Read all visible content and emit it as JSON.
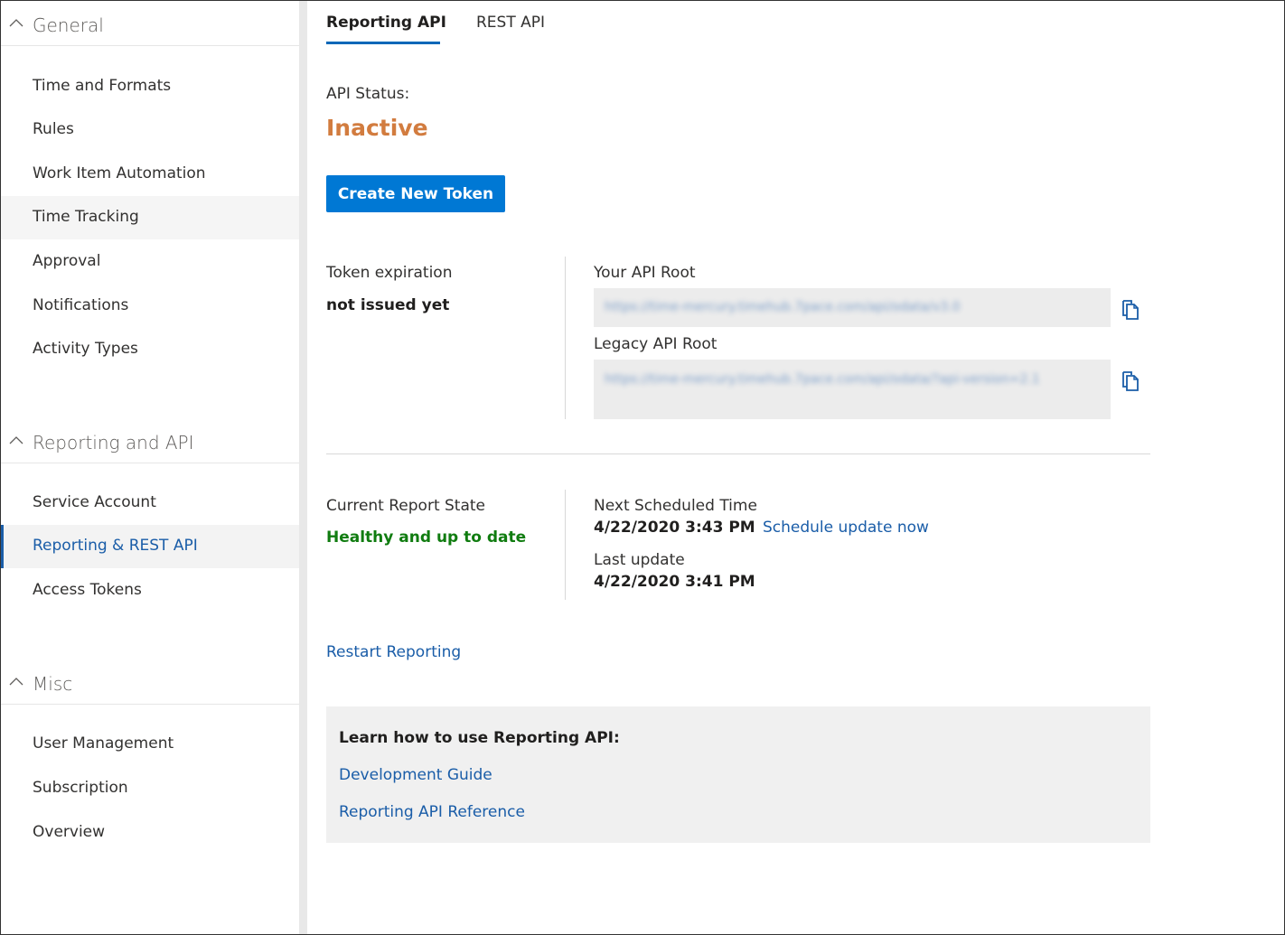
{
  "sidebar": {
    "groups": [
      {
        "title": "General",
        "items": [
          "Time and Formats",
          "Rules",
          "Work Item Automation",
          "Time Tracking",
          "Approval",
          "Notifications",
          "Activity Types"
        ]
      },
      {
        "title": "Reporting and API",
        "items": [
          "Service Account",
          "Reporting & REST API",
          "Access Tokens"
        ]
      },
      {
        "title": "Misc",
        "items": [
          "User Management",
          "Subscription",
          "Overview"
        ]
      }
    ],
    "active_item": "Reporting & REST API",
    "hover_item": "Time Tracking"
  },
  "tabs": [
    {
      "label": "Reporting API",
      "active": true
    },
    {
      "label": "REST API",
      "active": false
    }
  ],
  "api_status": {
    "label": "API Status:",
    "value": "Inactive"
  },
  "create_token_button": "Create New Token",
  "token": {
    "label": "Token expiration",
    "value": "not issued yet"
  },
  "api_root": {
    "label": "Your API Root",
    "url": "https://time-mercury.timehub.7pace.com/api/odata/v3.0",
    "copy_icon": "copy-icon"
  },
  "legacy_api_root": {
    "label": "Legacy API Root",
    "url": "https://time-mercury.timehub.7pace.com/api/odata/?api-version=2.1",
    "copy_icon": "copy-icon"
  },
  "report_state": {
    "label": "Current Report State",
    "value": "Healthy and up to date"
  },
  "next_scheduled": {
    "label": "Next Scheduled Time",
    "value": "4/22/2020 3:43 PM",
    "action": "Schedule update now"
  },
  "last_update": {
    "label": "Last update",
    "value": "4/22/2020 3:41 PM"
  },
  "restart_link": "Restart Reporting",
  "learn": {
    "heading": "Learn how to use Reporting API:",
    "links": [
      "Development Guide",
      "Reporting API Reference"
    ]
  },
  "colors": {
    "accent": "#0078d4",
    "link": "#1a5da8",
    "inactive_status": "#d27c3f",
    "healthy_status": "#107c10"
  }
}
